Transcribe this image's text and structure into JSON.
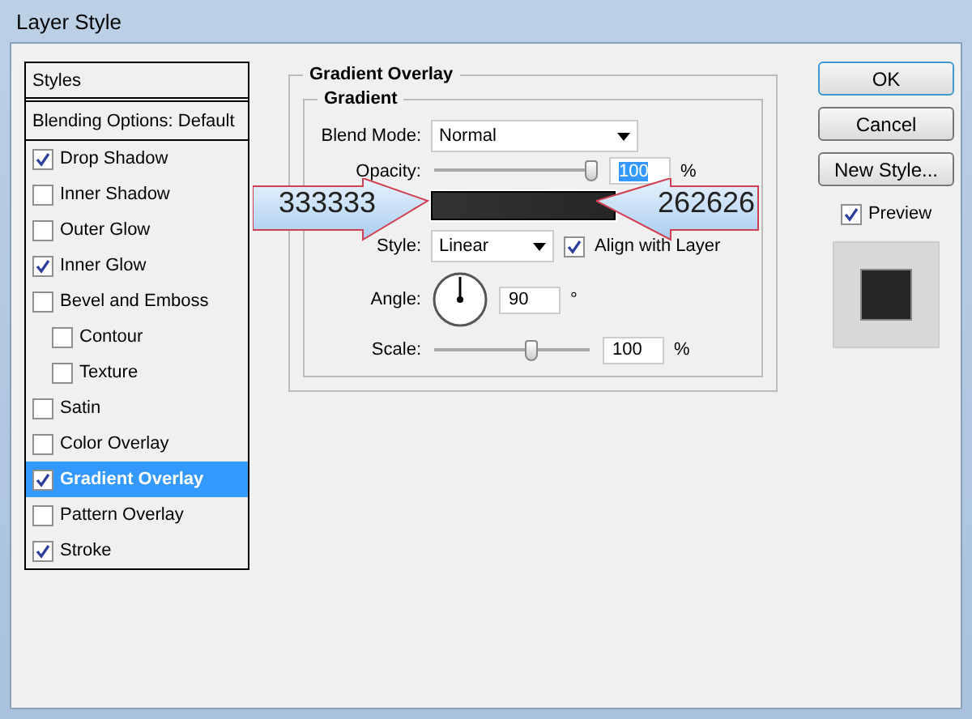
{
  "window": {
    "title": "Layer Style"
  },
  "styles_list": {
    "header": "Styles",
    "items": [
      {
        "label": "Blending Options: Default",
        "kind": "plain",
        "selected": false
      },
      {
        "label": "Drop Shadow",
        "kind": "check",
        "checked": true,
        "selected": false
      },
      {
        "label": "Inner Shadow",
        "kind": "check",
        "checked": false,
        "selected": false
      },
      {
        "label": "Outer Glow",
        "kind": "check",
        "checked": false,
        "selected": false
      },
      {
        "label": "Inner Glow",
        "kind": "check",
        "checked": true,
        "selected": false
      },
      {
        "label": "Bevel and Emboss",
        "kind": "check",
        "checked": false,
        "selected": false,
        "children": [
          {
            "label": "Contour",
            "kind": "check",
            "checked": false,
            "selected": false
          },
          {
            "label": "Texture",
            "kind": "check",
            "checked": false,
            "selected": false
          }
        ]
      },
      {
        "label": "Satin",
        "kind": "check",
        "checked": false,
        "selected": false
      },
      {
        "label": "Color Overlay",
        "kind": "check",
        "checked": false,
        "selected": false
      },
      {
        "label": "Gradient Overlay",
        "kind": "check",
        "checked": true,
        "selected": true
      },
      {
        "label": "Pattern Overlay",
        "kind": "check",
        "checked": false,
        "selected": false
      },
      {
        "label": "Stroke",
        "kind": "check",
        "checked": true,
        "selected": false
      }
    ]
  },
  "panel": {
    "title": "Gradient Overlay",
    "group": "Gradient",
    "blend_mode": {
      "label": "Blend Mode:",
      "value": "Normal"
    },
    "opacity": {
      "label": "Opacity:",
      "level": 0.97,
      "value": "100",
      "value_selected": true,
      "unit": "%"
    },
    "style": {
      "label": "Style:",
      "value": "Linear"
    },
    "align_with_layer": {
      "label": "Align with Layer",
      "checked": true
    },
    "angle": {
      "label": "Angle:",
      "value": "90",
      "unit": "°"
    },
    "scale": {
      "label": "Scale:",
      "level": 0.62,
      "value": "100",
      "unit": "%"
    }
  },
  "callouts": [
    {
      "text": "333333"
    },
    {
      "text": "262626"
    }
  ],
  "buttons": [
    {
      "label": "OK",
      "default": true
    },
    {
      "label": "Cancel",
      "default": false
    },
    {
      "label": "New Style...",
      "default": false
    }
  ],
  "preview": {
    "label": "Preview",
    "checked": true
  }
}
